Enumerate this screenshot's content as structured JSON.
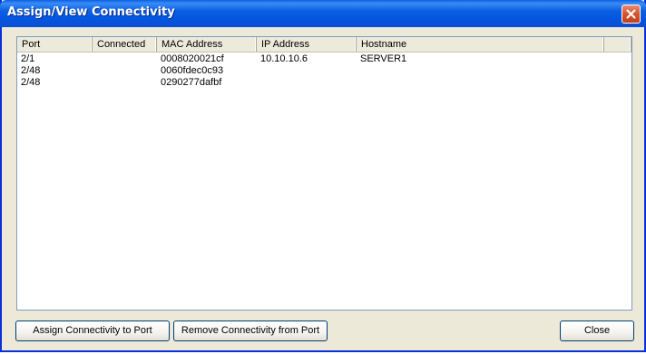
{
  "window": {
    "title": "Assign/View Connectivity"
  },
  "table": {
    "columns": [
      "Port",
      "Connected",
      "MAC Address",
      "IP Address",
      "Hostname"
    ],
    "rows": [
      {
        "port": "2/1",
        "connected": "",
        "mac": "0008020021cf",
        "ip": "10.10.10.6",
        "hostname": "SERVER1"
      },
      {
        "port": "2/48",
        "connected": "",
        "mac": "0060fdec0c93",
        "ip": "",
        "hostname": ""
      },
      {
        "port": "2/48",
        "connected": "",
        "mac": "0290277dafbf",
        "ip": "",
        "hostname": ""
      }
    ]
  },
  "buttons": {
    "assign": "Assign Connectivity to Port",
    "remove": "Remove Connectivity from Port",
    "close": "Close"
  },
  "icons": {
    "close": "close-icon"
  },
  "colors": {
    "titlebar": "#0a5fe3",
    "window_bg": "#ece9d8",
    "close_button": "#d4552f"
  }
}
